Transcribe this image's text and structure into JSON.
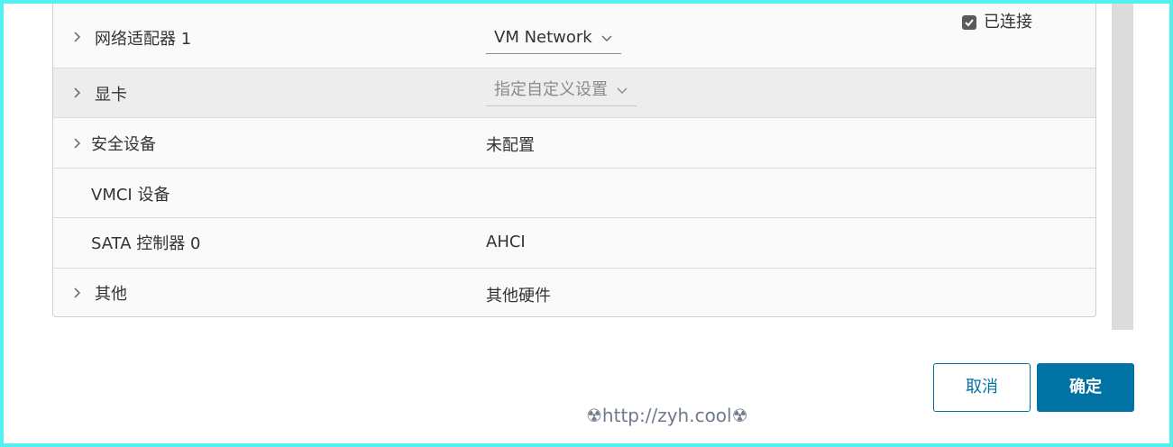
{
  "rows": [
    {
      "label": "网络适配器 1",
      "select_value": "VM Network",
      "checkbox_label": "已连接",
      "checkbox_checked": true,
      "expandable": true
    },
    {
      "label": "显卡",
      "select_value": "指定自定义设置",
      "select_disabled": true,
      "expandable": true
    },
    {
      "label": "安全设备",
      "value": "未配置",
      "expandable": true
    },
    {
      "label": "VMCI 设备",
      "value": "",
      "expandable": false
    },
    {
      "label": "SATA 控制器 0",
      "value": "AHCI",
      "expandable": false
    },
    {
      "label": "其他",
      "value": "其他硬件",
      "expandable": true
    }
  ],
  "footer": {
    "cancel_label": "取消",
    "ok_label": "确定"
  },
  "watermark": "☢http://zyh.cool☢",
  "colors": {
    "accent": "#0072a3",
    "page_border": "#55f0f0",
    "row_highlight": "#ededed"
  }
}
